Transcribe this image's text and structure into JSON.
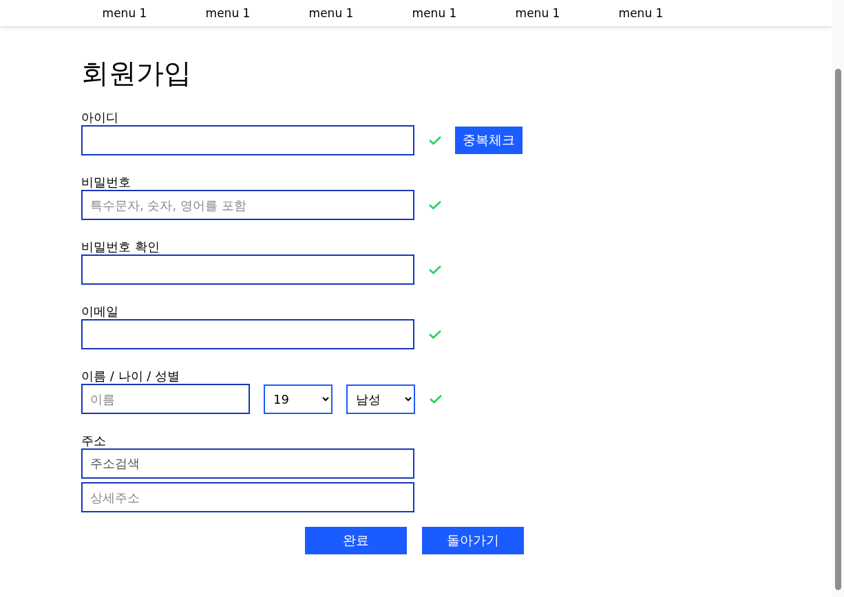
{
  "menu": [
    "menu 1",
    "menu 1",
    "menu 1",
    "menu 1",
    "menu 1",
    "menu 1"
  ],
  "title": "회원가입",
  "fields": [
    {
      "kind": "text",
      "label": "아이디",
      "valid": true,
      "button": "중복체크"
    },
    {
      "kind": "text",
      "label": "비밀번호",
      "placeholder": "특수문자, 숫자, 영어를 포함",
      "valid": true
    },
    {
      "kind": "text",
      "label": "비밀번호 확인",
      "valid": true
    },
    {
      "kind": "text",
      "label": "이메일",
      "valid": true
    },
    {
      "kind": "person",
      "label": "이름 / 나이 / 성별",
      "placeholder": "이름",
      "age": "19",
      "gender": "남성",
      "valid": true
    },
    {
      "kind": "address",
      "label": "주소",
      "value": "주소검색",
      "detail_placeholder": "상세주소",
      "valid": false
    }
  ],
  "actions": [
    "완료",
    "돌아가기"
  ]
}
